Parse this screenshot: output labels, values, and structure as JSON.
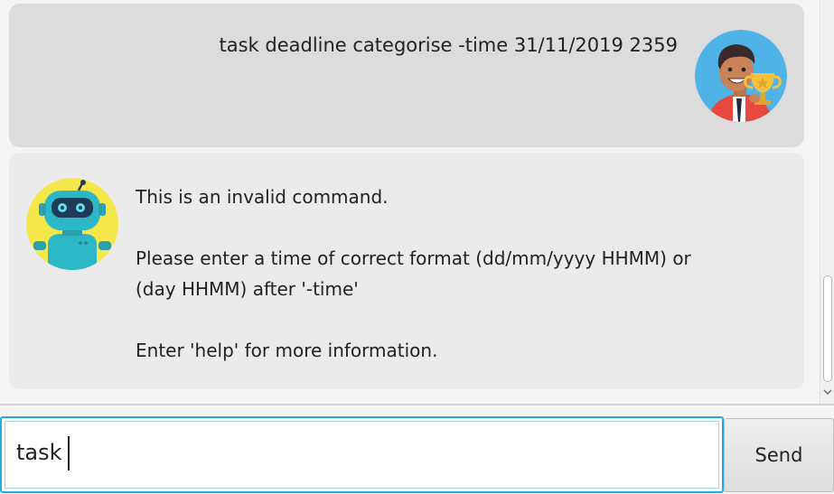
{
  "chat": {
    "user_message": "task deadline categorise -time 31/11/2019 2359",
    "bot_message": {
      "line1": "This is an invalid command.",
      "line2": "Please enter a time of correct format (dd/mm/yyyy HHMM) or",
      "line3": "(day HHMM) after '-time'",
      "line4": "Enter 'help' for more information."
    }
  },
  "icons": {
    "user_avatar": "user-avatar-with-trophy",
    "bot_avatar": "robot-avatar",
    "scroll_up": "chevron-up-icon",
    "scroll_down": "chevron-down-icon"
  },
  "input": {
    "value": "task"
  },
  "send": {
    "label": "Send"
  },
  "colors": {
    "accent": "#29a8e0",
    "user_bubble": "#dcdcdc",
    "bot_bubble": "#ebebeb"
  }
}
